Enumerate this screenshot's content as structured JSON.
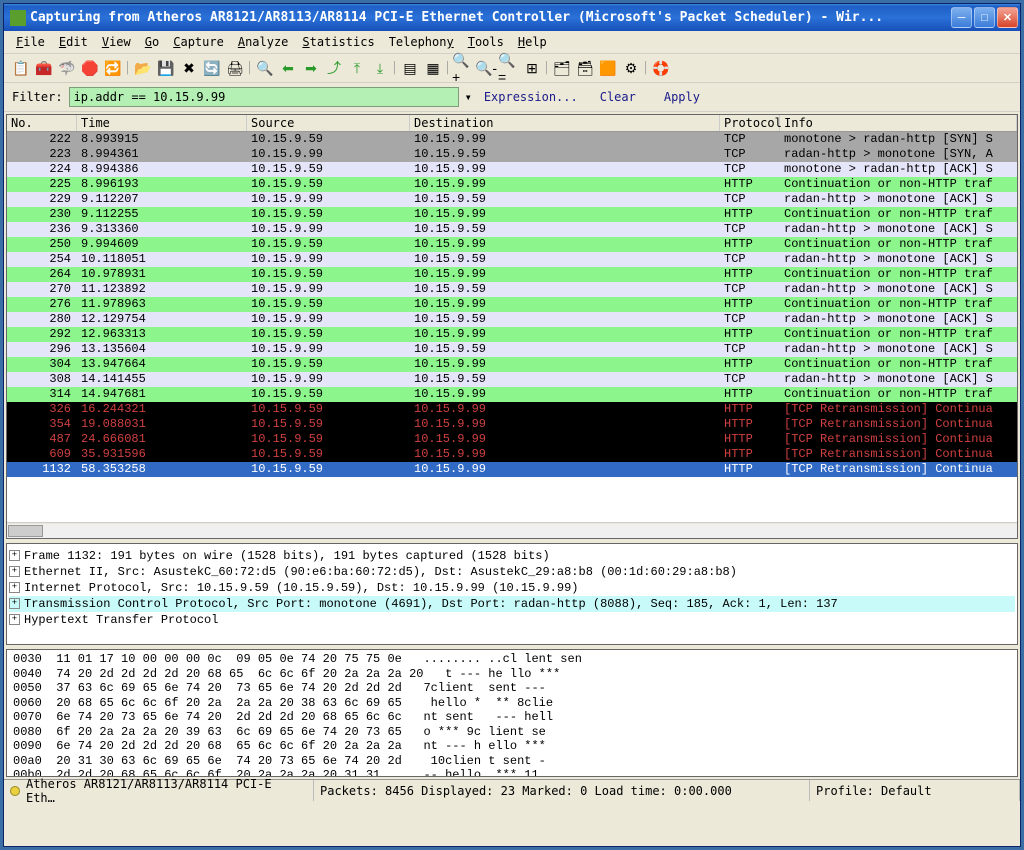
{
  "title": "Capturing from Atheros AR8121/AR8113/AR8114 PCI-E Ethernet Controller (Microsoft's Packet Scheduler) - Wir...",
  "menu": [
    "File",
    "Edit",
    "View",
    "Go",
    "Capture",
    "Analyze",
    "Statistics",
    "Telephony",
    "Tools",
    "Help"
  ],
  "filter": {
    "label": "Filter:",
    "value": "ip.addr == 10.15.9.99",
    "expression": "Expression...",
    "clear": "Clear",
    "apply": "Apply"
  },
  "columns": [
    "No.",
    "Time",
    "Source",
    "Destination",
    "Protocol",
    "Info"
  ],
  "packets": [
    {
      "no": "222",
      "time": "8.993915",
      "src": "10.15.9.59",
      "dst": "10.15.9.99",
      "proto": "TCP",
      "info": "monotone > radan-http [SYN] S",
      "style": "gray"
    },
    {
      "no": "223",
      "time": "8.994361",
      "src": "10.15.9.99",
      "dst": "10.15.9.59",
      "proto": "TCP",
      "info": "radan-http > monotone [SYN, A",
      "style": "gray"
    },
    {
      "no": "224",
      "time": "8.994386",
      "src": "10.15.9.59",
      "dst": "10.15.9.99",
      "proto": "TCP",
      "info": "monotone > radan-http [ACK] S",
      "style": "lav"
    },
    {
      "no": "225",
      "time": "8.996193",
      "src": "10.15.9.59",
      "dst": "10.15.9.99",
      "proto": "HTTP",
      "info": "Continuation or non-HTTP traf",
      "style": "green"
    },
    {
      "no": "229",
      "time": "9.112207",
      "src": "10.15.9.99",
      "dst": "10.15.9.59",
      "proto": "TCP",
      "info": "radan-http > monotone [ACK] S",
      "style": "lav"
    },
    {
      "no": "230",
      "time": "9.112255",
      "src": "10.15.9.59",
      "dst": "10.15.9.99",
      "proto": "HTTP",
      "info": "Continuation or non-HTTP traf",
      "style": "green"
    },
    {
      "no": "236",
      "time": "9.313360",
      "src": "10.15.9.99",
      "dst": "10.15.9.59",
      "proto": "TCP",
      "info": "radan-http > monotone [ACK] S",
      "style": "lav"
    },
    {
      "no": "250",
      "time": "9.994609",
      "src": "10.15.9.59",
      "dst": "10.15.9.99",
      "proto": "HTTP",
      "info": "Continuation or non-HTTP traf",
      "style": "green"
    },
    {
      "no": "254",
      "time": "10.118051",
      "src": "10.15.9.99",
      "dst": "10.15.9.59",
      "proto": "TCP",
      "info": "radan-http > monotone [ACK] S",
      "style": "lav"
    },
    {
      "no": "264",
      "time": "10.978931",
      "src": "10.15.9.59",
      "dst": "10.15.9.99",
      "proto": "HTTP",
      "info": "Continuation or non-HTTP traf",
      "style": "green"
    },
    {
      "no": "270",
      "time": "11.123892",
      "src": "10.15.9.99",
      "dst": "10.15.9.59",
      "proto": "TCP",
      "info": "radan-http > monotone [ACK] S",
      "style": "lav"
    },
    {
      "no": "276",
      "time": "11.978963",
      "src": "10.15.9.59",
      "dst": "10.15.9.99",
      "proto": "HTTP",
      "info": "Continuation or non-HTTP traf",
      "style": "green"
    },
    {
      "no": "280",
      "time": "12.129754",
      "src": "10.15.9.99",
      "dst": "10.15.9.59",
      "proto": "TCP",
      "info": "radan-http > monotone [ACK] S",
      "style": "lav"
    },
    {
      "no": "292",
      "time": "12.963313",
      "src": "10.15.9.59",
      "dst": "10.15.9.99",
      "proto": "HTTP",
      "info": "Continuation or non-HTTP traf",
      "style": "green"
    },
    {
      "no": "296",
      "time": "13.135604",
      "src": "10.15.9.99",
      "dst": "10.15.9.59",
      "proto": "TCP",
      "info": "radan-http > monotone [ACK] S",
      "style": "lav"
    },
    {
      "no": "304",
      "time": "13.947664",
      "src": "10.15.9.59",
      "dst": "10.15.9.99",
      "proto": "HTTP",
      "info": "Continuation or non-HTTP traf",
      "style": "green"
    },
    {
      "no": "308",
      "time": "14.141455",
      "src": "10.15.9.99",
      "dst": "10.15.9.59",
      "proto": "TCP",
      "info": "radan-http > monotone [ACK] S",
      "style": "lav"
    },
    {
      "no": "314",
      "time": "14.947681",
      "src": "10.15.9.59",
      "dst": "10.15.9.99",
      "proto": "HTTP",
      "info": "Continuation or non-HTTP traf",
      "style": "green"
    },
    {
      "no": "326",
      "time": "16.244321",
      "src": "10.15.9.59",
      "dst": "10.15.9.99",
      "proto": "HTTP",
      "info": "[TCP Retransmission] Continua",
      "style": "black"
    },
    {
      "no": "354",
      "time": "19.088031",
      "src": "10.15.9.59",
      "dst": "10.15.9.99",
      "proto": "HTTP",
      "info": "[TCP Retransmission] Continua",
      "style": "black"
    },
    {
      "no": "487",
      "time": "24.666081",
      "src": "10.15.9.59",
      "dst": "10.15.9.99",
      "proto": "HTTP",
      "info": "[TCP Retransmission] Continua",
      "style": "black"
    },
    {
      "no": "609",
      "time": "35.931596",
      "src": "10.15.9.59",
      "dst": "10.15.9.99",
      "proto": "HTTP",
      "info": "[TCP Retransmission] Continua",
      "style": "black"
    },
    {
      "no": "1132",
      "time": "58.353258",
      "src": "10.15.9.59",
      "dst": "10.15.9.99",
      "proto": "HTTP",
      "info": "[TCP Retransmission] Continua",
      "style": "selected"
    }
  ],
  "tree": [
    {
      "text": "Frame 1132: 191 bytes on wire (1528 bits), 191 bytes captured (1528 bits)",
      "hl": false
    },
    {
      "text": "Ethernet II, Src: AsustekC_60:72:d5 (90:e6:ba:60:72:d5), Dst: AsustekC_29:a8:b8 (00:1d:60:29:a8:b8)",
      "hl": false
    },
    {
      "text": "Internet Protocol, Src: 10.15.9.59 (10.15.9.59), Dst: 10.15.9.99 (10.15.9.99)",
      "hl": false
    },
    {
      "text": "Transmission Control Protocol, Src Port: monotone (4691), Dst Port: radan-http (8088), Seq: 185, Ack: 1, Len: 137",
      "hl": true
    },
    {
      "text": "Hypertext Transfer Protocol",
      "hl": false
    }
  ],
  "hex": [
    "0030  11 01 17 10 00 00 00 0c  09 05 0e 74 20 75 75 0e   ........ ..cl lent sen",
    "0040  74 20 2d 2d 2d 2d 20 68 65  6c 6c 6f 20 2a 2a 2a 20   t --- he llo ***",
    "0050  37 63 6c 69 65 6e 74 20  73 65 6e 74 20 2d 2d 2d   7client  sent ---",
    "0060  20 68 65 6c 6c 6f 20 2a  2a 2a 20 38 63 6c 69 65    hello *  ** 8clie",
    "0070  6e 74 20 73 65 6e 74 20  2d 2d 2d 20 68 65 6c 6c   nt sent   --- hell",
    "0080  6f 20 2a 2a 2a 20 39 63  6c 69 65 6e 74 20 73 65   o *** 9c lient se",
    "0090  6e 74 20 2d 2d 2d 20 68  65 6c 6c 6f 20 2a 2a 2a   nt --- h ello ***",
    "00a0  20 31 30 63 6c 69 65 6e  74 20 73 65 6e 74 20 2d    10clien t sent -",
    "00b0  2d 2d 20 68 65 6c 6c 6f  20 2a 2a 2a 20 31 31      -- hello  *** 11"
  ],
  "status": {
    "iface": "Atheros AR8121/AR8113/AR8114 PCI-E Eth…",
    "pkts": "Packets: 8456 Displayed: 23 Marked: 0 Load time: 0:00.000",
    "profile": "Profile: Default"
  }
}
